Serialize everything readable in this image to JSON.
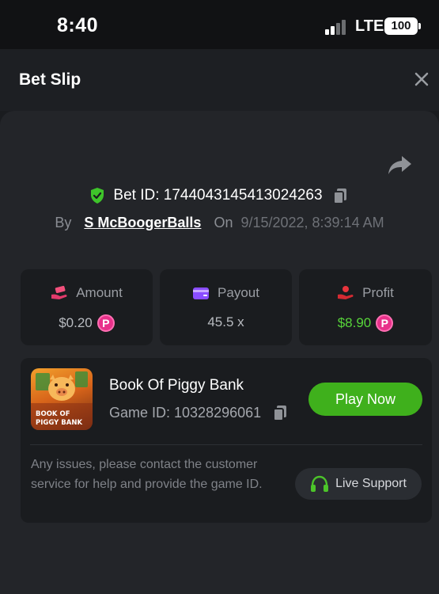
{
  "status_bar": {
    "time": "8:40",
    "network": "LTE",
    "battery": "100"
  },
  "header": {
    "title": "Bet Slip",
    "close_icon": "close-icon"
  },
  "bet": {
    "bet_id_text": "Bet ID: 1744043145413024263",
    "by_label": "By",
    "username": "S McBoogerBalls",
    "on_label": "On",
    "datetime": "9/15/2022, 8:39:14 AM"
  },
  "stats": {
    "amount": {
      "label": "Amount",
      "value": "$0.20",
      "icon": "money-hand-icon"
    },
    "payout": {
      "label": "Payout",
      "value": "45.5 x",
      "icon": "wallet-icon"
    },
    "profit": {
      "label": "Profit",
      "value": "$8.90",
      "icon": "profit-hand-icon"
    }
  },
  "currency_symbol": "P",
  "game": {
    "title": "Book Of Piggy Bank",
    "game_id_text": "Game ID: 10328296061",
    "thumb_text_1": "BOOK OF",
    "thumb_text_2": "PIGGY BANK",
    "play_button": "Play Now"
  },
  "support": {
    "help_text": "Any issues, please contact the customer service for help and provide the game ID.",
    "button_label": "Live Support"
  },
  "colors": {
    "accent_green": "#3fb01c",
    "profit_green": "#57d43a",
    "coin_pink": "#e8318a",
    "background": "#1a1c1f"
  }
}
